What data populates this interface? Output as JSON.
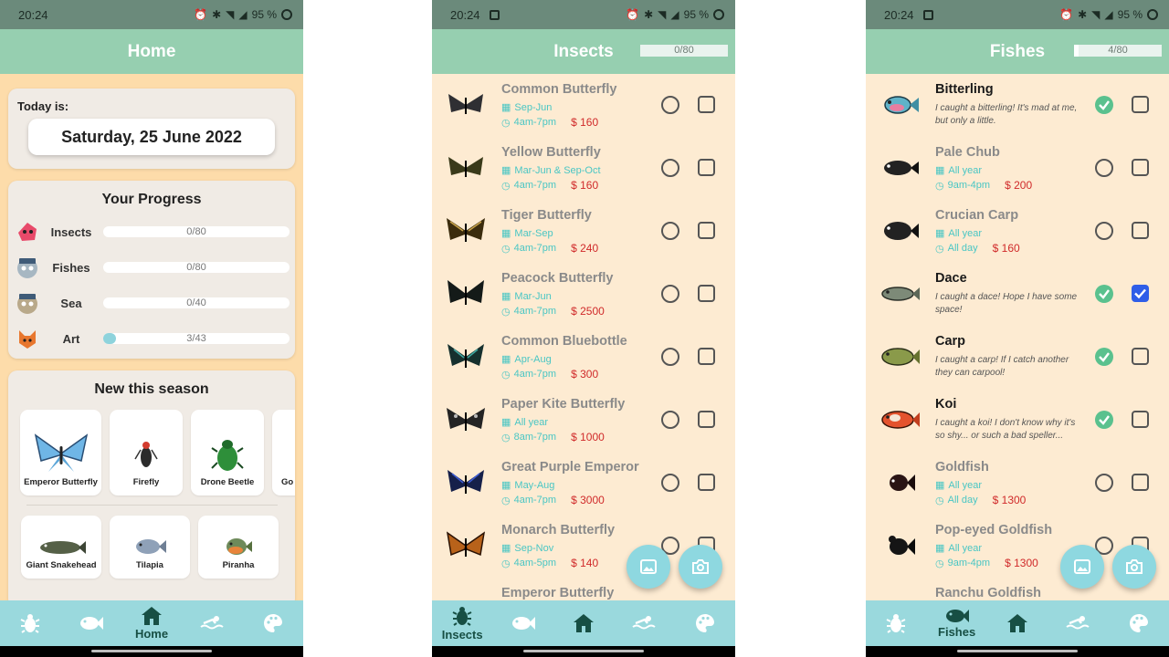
{
  "status": {
    "time": "20:24",
    "battery": "95 %"
  },
  "home": {
    "title": "Home",
    "today_label": "Today is:",
    "date": "Saturday, 25 June 2022",
    "progress_title": "Your Progress",
    "progress": [
      {
        "label": "Insects",
        "value": "0/80",
        "fraction": 0
      },
      {
        "label": "Fishes",
        "value": "0/80",
        "fraction": 0
      },
      {
        "label": "Sea",
        "value": "0/40",
        "fraction": 0
      },
      {
        "label": "Art",
        "value": "3/43",
        "fraction": 0.07
      }
    ],
    "season_title": "New this season",
    "season_insects": [
      "Emperor Butterfly",
      "Firefly",
      "Drone Beetle",
      "Go"
    ],
    "season_fishes": [
      "Giant Snakehead",
      "Tilapia",
      "Piranha"
    ]
  },
  "insects": {
    "title": "Insects",
    "progress_text": "0/80",
    "progress_fraction": 0,
    "items": [
      {
        "name": "Common Butterfly",
        "months": "Sep-Jun",
        "time": "4am-7pm",
        "price": "160",
        "color": "#2f2f33"
      },
      {
        "name": "Yellow Butterfly",
        "months": "Mar-Jun & Sep-Oct",
        "time": "4am-7pm",
        "price": "160",
        "color": "#3a3a1a"
      },
      {
        "name": "Tiger Butterfly",
        "months": "Mar-Sep",
        "time": "4am-7pm",
        "price": "240",
        "color": "#3b2c0d"
      },
      {
        "name": "Peacock Butterfly",
        "months": "Mar-Jun",
        "time": "4am-7pm",
        "price": "2500",
        "color": "#141a18"
      },
      {
        "name": "Common Bluebottle",
        "months": "Apr-Aug",
        "time": "4am-7pm",
        "price": "300",
        "color": "#16302e"
      },
      {
        "name": "Paper Kite Butterfly",
        "months": "All year",
        "time": "8am-7pm",
        "price": "1000",
        "color": "#242424"
      },
      {
        "name": "Great Purple Emperor",
        "months": "May-Aug",
        "time": "4am-7pm",
        "price": "3000",
        "color": "#16204a"
      },
      {
        "name": "Monarch Butterfly",
        "months": "Sep-Nov",
        "time": "4am-5pm",
        "price": "140",
        "color": "#4a2708"
      },
      {
        "name": "Emperor Butterfly",
        "months": "",
        "time": "",
        "price": "",
        "color": "#1a2a3a"
      }
    ]
  },
  "fishes": {
    "title": "Fishes",
    "progress_text": "4/80",
    "progress_fraction": 0.05,
    "items": [
      {
        "name": "Bitterling",
        "quote": "I caught a bitterling! It's mad at me, but only a little.",
        "caught": true,
        "donated": false,
        "color": "#5fb3c9"
      },
      {
        "name": "Pale Chub",
        "months": "All year",
        "time": "9am-4pm",
        "price": "200",
        "caught": false,
        "donated": false,
        "color": "#222"
      },
      {
        "name": "Crucian Carp",
        "months": "All year",
        "time": "All day",
        "price": "160",
        "caught": false,
        "donated": false,
        "color": "#222"
      },
      {
        "name": "Dace",
        "quote": "I caught a dace! Hope I have some space!",
        "caught": true,
        "donated": true,
        "color": "#6f7a6a"
      },
      {
        "name": "Carp",
        "quote": "I caught a carp! If I catch another they can carpool!",
        "caught": true,
        "donated": false,
        "color": "#556b32"
      },
      {
        "name": "Koi",
        "quote": "I caught a koi! I don't know why it's so shy... or such a bad speller...",
        "caught": true,
        "donated": false,
        "color": "#e4532e"
      },
      {
        "name": "Goldfish",
        "months": "All year",
        "time": "All day",
        "price": "1300",
        "caught": false,
        "donated": false,
        "color": "#2a1414"
      },
      {
        "name": "Pop-eyed Goldfish",
        "months": "All year",
        "time": "9am-4pm",
        "price": "1300",
        "caught": false,
        "donated": false,
        "color": "#151515"
      },
      {
        "name": "Ranchu Goldfish",
        "months": "",
        "time": "",
        "price": "",
        "caught": false,
        "donated": false,
        "color": "#222"
      }
    ]
  },
  "nav": {
    "home_label": "Home",
    "insects_label": "Insects",
    "fishes_label": "Fishes"
  },
  "colors": {
    "header": "#96cfb0",
    "nav": "#9ad9dd",
    "accent": "#49c6c4",
    "price": "#d02a2a",
    "check": "#5ac18e",
    "donated": "#2f5ee8"
  }
}
